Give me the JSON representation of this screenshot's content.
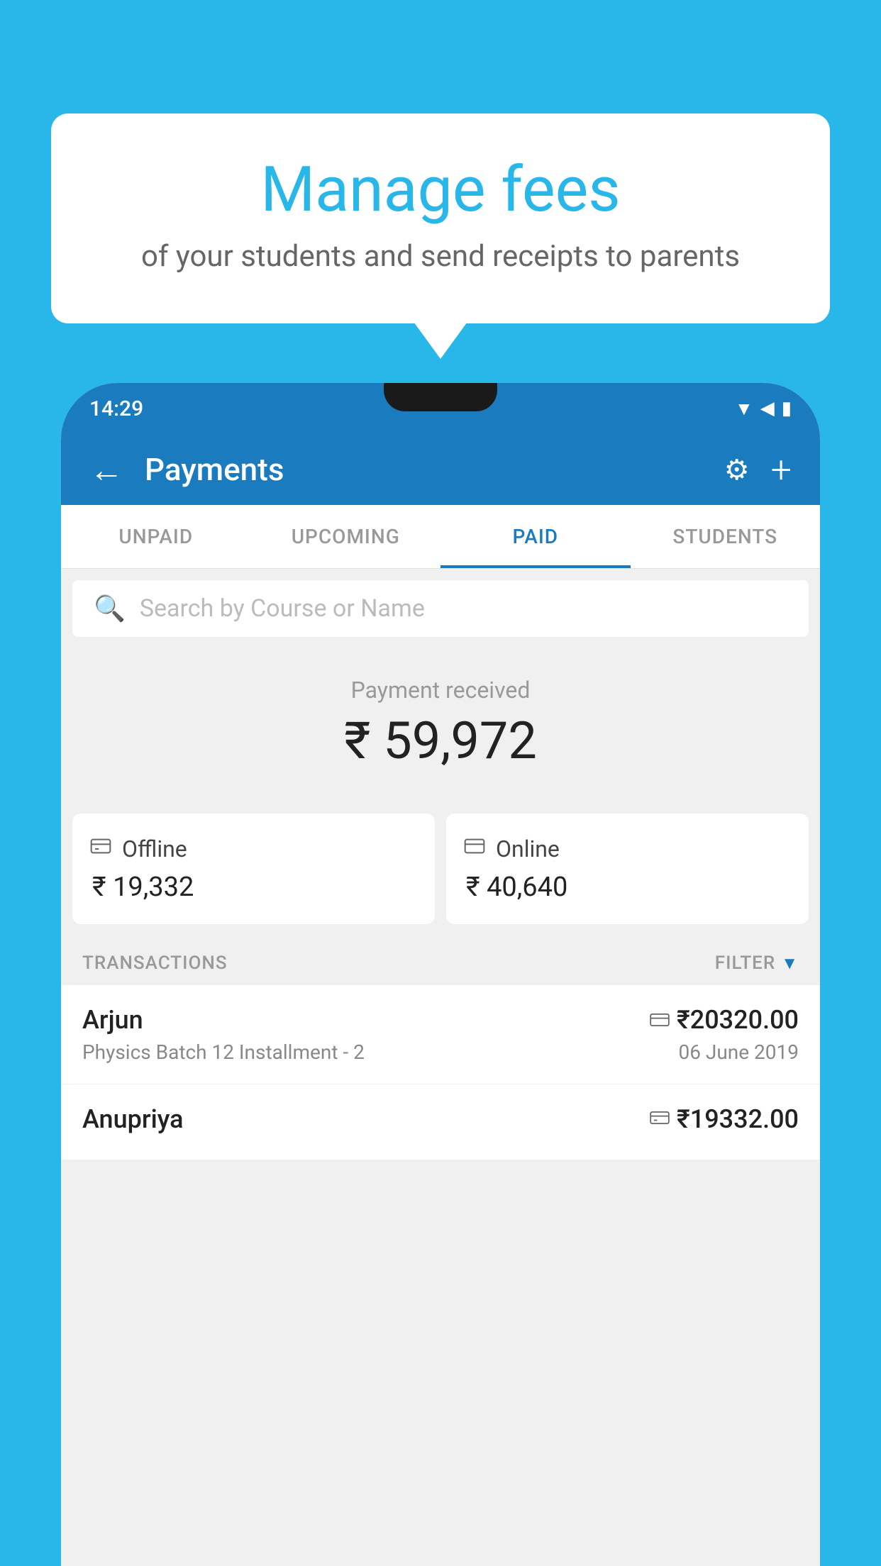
{
  "background_color": "#29b6e8",
  "speech_bubble": {
    "title": "Manage fees",
    "subtitle": "of your students and send receipts to parents"
  },
  "phone": {
    "status_bar": {
      "time": "14:29",
      "icons": "▼◀▮"
    },
    "app_bar": {
      "back_icon": "←",
      "title": "Payments",
      "settings_icon": "⚙",
      "add_icon": "+"
    },
    "tabs": [
      {
        "label": "UNPAID",
        "active": false
      },
      {
        "label": "UPCOMING",
        "active": false
      },
      {
        "label": "PAID",
        "active": true
      },
      {
        "label": "STUDENTS",
        "active": false
      }
    ],
    "search": {
      "placeholder": "Search by Course or Name",
      "icon": "search-icon"
    },
    "payment_summary": {
      "label": "Payment received",
      "amount": "₹ 59,972",
      "offline_label": "Offline",
      "offline_amount": "₹ 19,332",
      "online_label": "Online",
      "online_amount": "₹ 40,640"
    },
    "transactions": {
      "section_label": "TRANSACTIONS",
      "filter_label": "FILTER",
      "items": [
        {
          "name": "Arjun",
          "method_icon": "card",
          "amount": "₹20320.00",
          "course": "Physics Batch 12 Installment - 2",
          "date": "06 June 2019"
        },
        {
          "name": "Anupriya",
          "method_icon": "cash",
          "amount": "₹19332.00",
          "course": "",
          "date": ""
        }
      ]
    }
  }
}
